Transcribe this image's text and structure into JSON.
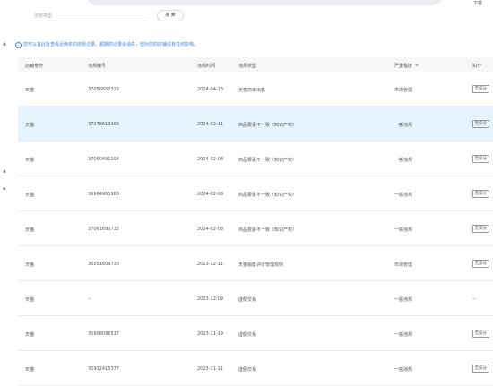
{
  "header": {
    "download_label": "下载"
  },
  "filter": {
    "placeholder": "违规类型",
    "search_label": "搜 索"
  },
  "notice": {
    "icon": "info-icon",
    "text": "您可以在此处查看近两年的违规记录。超期的记录会消失，但对您的店铺没有任何影响。"
  },
  "table": {
    "columns": [
      "店铺身份",
      "违规编号",
      "违规时间",
      "违规类型",
      "严重程度",
      "扣分"
    ],
    "rows": [
      {
        "shop": "天猫",
        "id": "37056652323",
        "date": "2024-04-13",
        "type": "天猫商家出售",
        "severity": "市场管理",
        "deduct": "无扣分",
        "deduct_tag": true
      },
      {
        "shop": "天猫",
        "id": "37078613399",
        "date": "2024-02-11",
        "type": "商品要素不一致（知识产权）",
        "severity": "一般违规",
        "deduct": "无扣分",
        "deduct_tag": true
      },
      {
        "shop": "天猫",
        "id": "37060491194",
        "date": "2024-02-08",
        "type": "商品要素不一致（知识产权）",
        "severity": "一般违规",
        "deduct": "无扣分",
        "deduct_tag": true
      },
      {
        "shop": "天猫",
        "id": "36984965988",
        "date": "2024-02-08",
        "type": "商品要素不一致（知识产权）",
        "severity": "一般违规",
        "deduct": "无扣分",
        "deduct_tag": true
      },
      {
        "shop": "天猫",
        "id": "37061690732",
        "date": "2024-02-08",
        "type": "商品要素不一致（知识产权）",
        "severity": "一般违规",
        "deduct": "无扣分",
        "deduct_tag": true
      },
      {
        "shop": "天猫",
        "id": "36051609730",
        "date": "2023-12-11",
        "type": "天猫销售评价管理规则",
        "severity": "市场管理",
        "deduct": "无扣分",
        "deduct_tag": true
      },
      {
        "shop": "天猫",
        "id": "--",
        "date": "2023-12-09",
        "type": "虚假交易",
        "severity": "一般违规",
        "deduct": "--",
        "deduct_tag": false
      },
      {
        "shop": "天猫",
        "id": "35908096537",
        "date": "2023-11-19",
        "type": "虚假交易",
        "severity": "一般违规",
        "deduct": "无扣分",
        "deduct_tag": true
      },
      {
        "shop": "天猫",
        "id": "35932415377",
        "date": "2023-11-11",
        "type": "虚假交易",
        "severity": "一般违规",
        "deduct": "无扣分",
        "deduct_tag": true
      }
    ]
  }
}
